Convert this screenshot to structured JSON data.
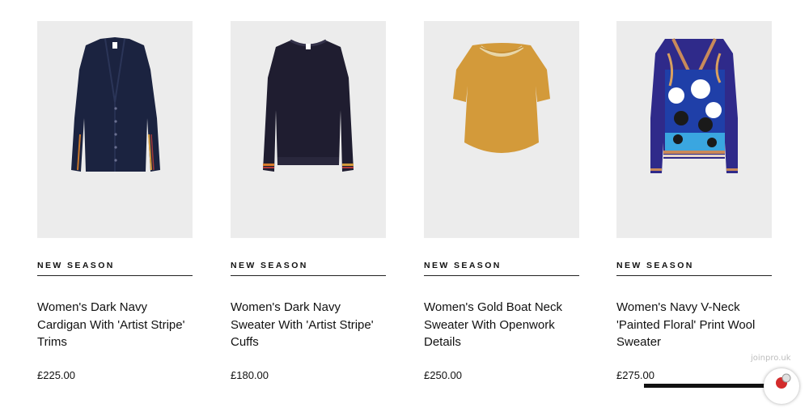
{
  "products": [
    {
      "badge": "NEW SEASON",
      "title": "Women's Dark Navy Cardigan With 'Artist Stripe' Trims",
      "price": "£225.00"
    },
    {
      "badge": "NEW SEASON",
      "title": "Women's Dark Navy Sweater With 'Artist Stripe' Cuffs",
      "price": "£180.00"
    },
    {
      "badge": "NEW SEASON",
      "title": "Women's Gold Boat Neck Sweater With Openwork Details",
      "price": "£250.00"
    },
    {
      "badge": "NEW SEASON",
      "title": "Women's Navy V-Neck 'Painted Floral' Print Wool Sweater",
      "price": "£275.00"
    }
  ],
  "watermark": "joinpro.uk",
  "colors": {
    "image_bg": "#ececec",
    "navy": "#1b2340",
    "dark_navy": "#1f1d30",
    "gold": "#d39a3a",
    "royal": "#2f2a8a"
  }
}
